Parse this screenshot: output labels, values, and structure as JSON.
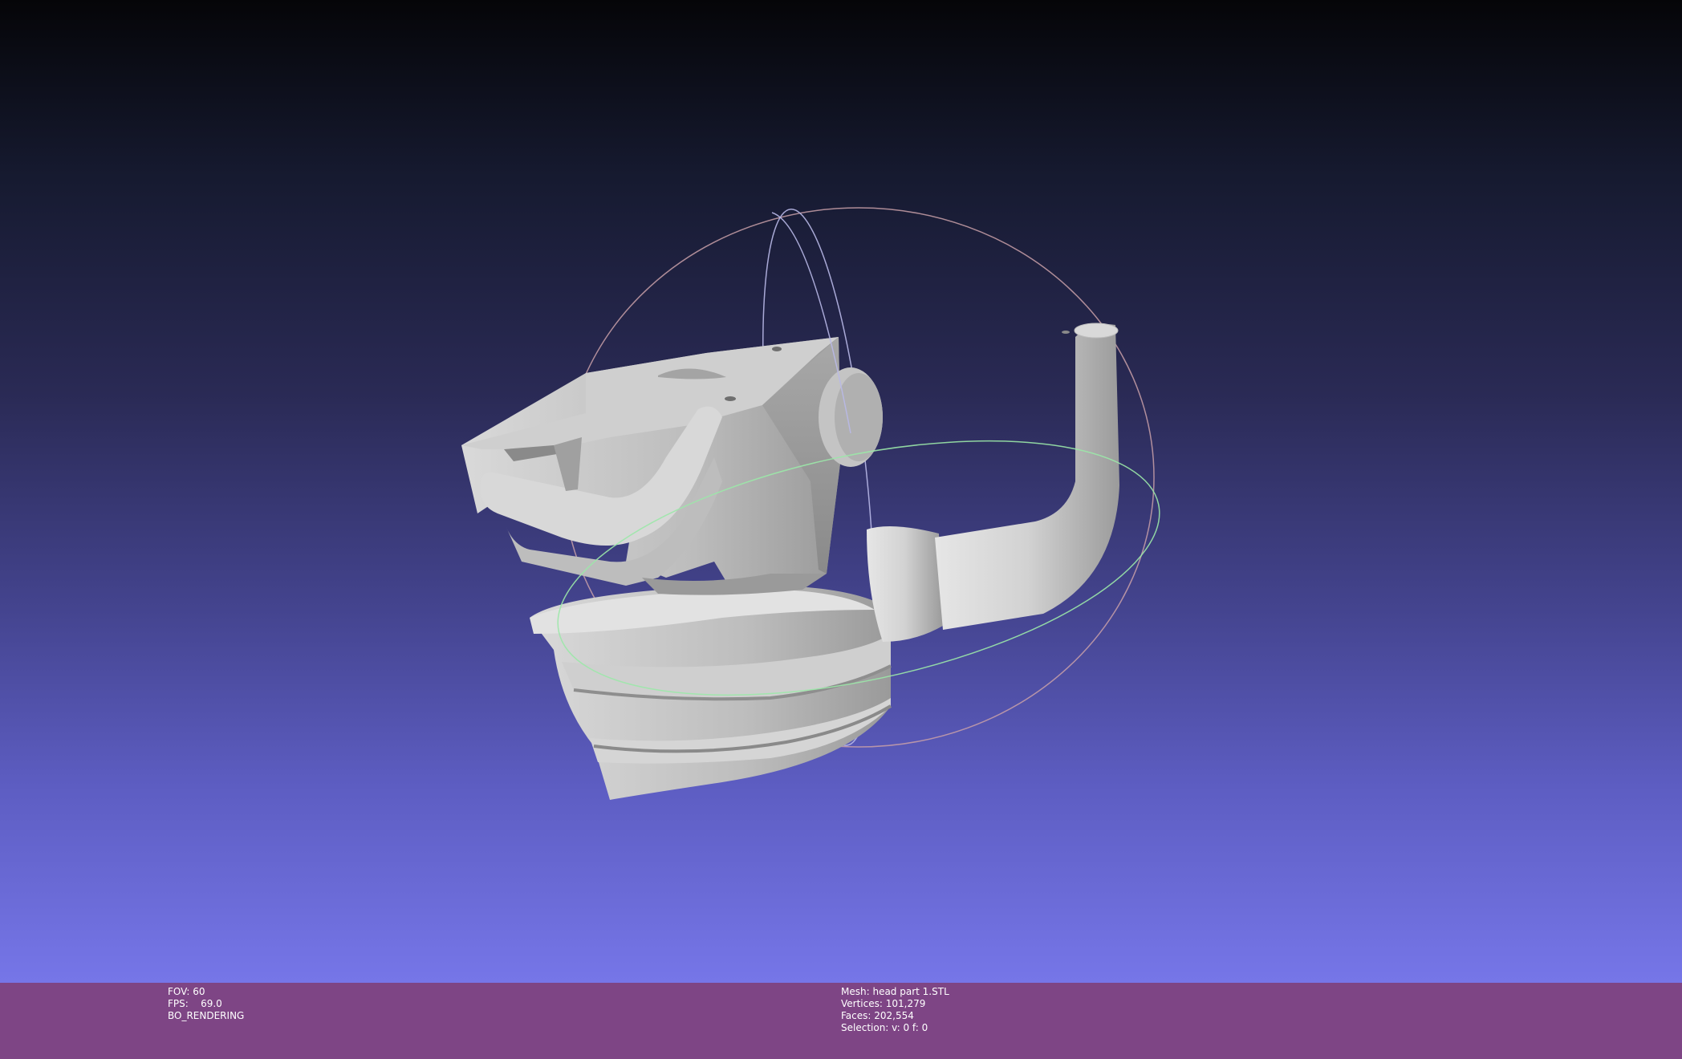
{
  "window": {
    "background_top": "#050508",
    "background_bottom": "#7676e8",
    "status_bar_color": "#7e4585"
  },
  "render_info": {
    "fov_label": "FOV:",
    "fov_value": "60",
    "fps_label": "FPS:",
    "fps_value": "69.0",
    "mode": "BO_RENDERING"
  },
  "mesh_info": {
    "mesh_label": "Mesh:",
    "mesh_name": "head part 1.STL",
    "vertices_label": "Vertices:",
    "vertices_value": "101,279",
    "faces_label": "Faces:",
    "faces_value": "202,554",
    "selection_label": "Selection:",
    "selection_value": "v: 0 f: 0"
  },
  "trackball": {
    "icon": "trackball-gizmo-icon",
    "x_ring_color": "#b9b9e8",
    "y_ring_color": "#c9a0a8",
    "z_ring_color": "#9be8a8"
  },
  "mesh": {
    "icon": "mesh-model-icon",
    "fill_color": "#c8c8c8"
  }
}
